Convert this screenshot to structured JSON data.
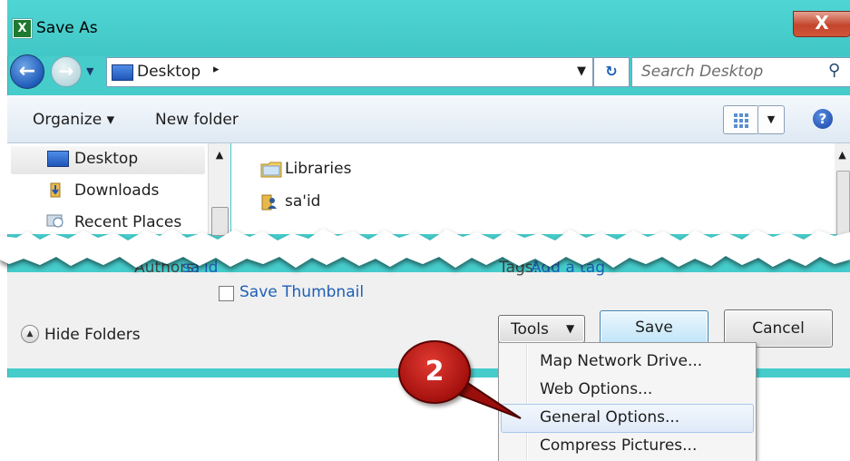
{
  "window": {
    "title": "Save As",
    "close_label": "X"
  },
  "nav": {
    "address": "Desktop",
    "address_separator": "▸",
    "search_placeholder": "Search Desktop"
  },
  "toolbar": {
    "organize": "Organize ▾",
    "new_folder": "New folder",
    "help": "?"
  },
  "sidebar": {
    "items": [
      {
        "label": "Desktop"
      },
      {
        "label": "Downloads"
      },
      {
        "label": "Recent Places"
      }
    ]
  },
  "files": [
    {
      "label": "Libraries"
    },
    {
      "label": "sa'id"
    }
  ],
  "properties": {
    "authors_label": "Authors:",
    "authors_value": "sa'id",
    "tags_label": "Tags:",
    "tags_value": "Add a tag"
  },
  "options": {
    "save_thumbnail": "Save Thumbnail",
    "hide_folders": "Hide Folders"
  },
  "buttons": {
    "tools": "Tools",
    "save": "Save",
    "cancel": "Cancel"
  },
  "tools_menu": {
    "items": [
      {
        "label": "Map Network Drive..."
      },
      {
        "label": "Web Options..."
      },
      {
        "label": "General Options..."
      },
      {
        "label": "Compress Pictures..."
      }
    ]
  },
  "callout": {
    "step": "2"
  },
  "colors": {
    "frame": "#45cccb",
    "accent_link": "#1d5fb6",
    "callout": "#b11612"
  }
}
